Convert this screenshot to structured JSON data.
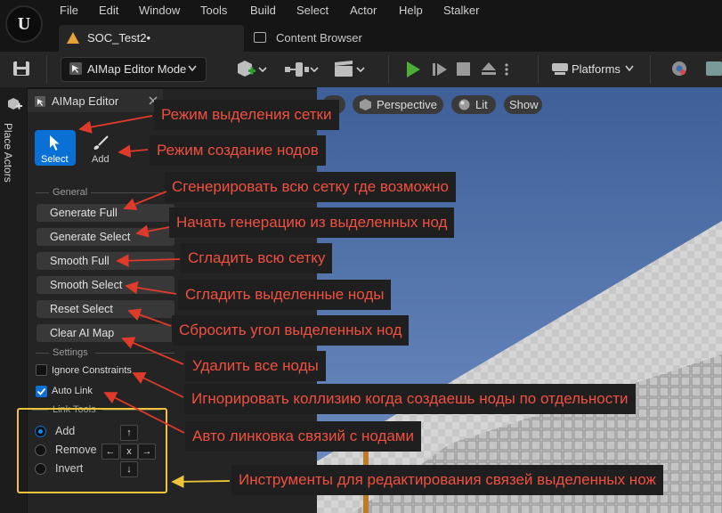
{
  "app": {
    "logo": "U"
  },
  "menu": [
    "File",
    "Edit",
    "Window",
    "Tools",
    "Build",
    "Select",
    "Actor",
    "Help",
    "Stalker"
  ],
  "tabs": {
    "level": "SOC_Test2•",
    "content_browser": "Content Browser"
  },
  "toolbar": {
    "mode": "AIMap Editor Mode",
    "platforms": "Platforms"
  },
  "sidebar": {
    "place_actors": "Place Actors"
  },
  "panel": {
    "title": "AIMap Editor",
    "modes": {
      "select": "Select",
      "add": "Add"
    },
    "general_header": "General",
    "buttons": [
      "Generate Full",
      "Generate Select",
      "Smooth Full",
      "Smooth Select",
      "Reset Select",
      "Clear AI Map"
    ],
    "settings_header": "Settings",
    "ignore_constraints": "Ignore Constraints",
    "auto_link": "Auto Link",
    "link_tools_header": "Link Tools",
    "link_options": [
      "Add",
      "Remove",
      "Invert"
    ],
    "arrows": {
      "up": "↑",
      "left": "←",
      "center": "x",
      "right": "→",
      "down": "↓"
    }
  },
  "viewport": {
    "perspective": "Perspective",
    "lit": "Lit",
    "show": "Show"
  },
  "annotations": [
    "Режим выделения сетки",
    "Режим создание нодов",
    "Сгенерировать всю сетку где возможно",
    "Начать генерацию из выделенных нод",
    "Сгладить всю сетку",
    "Сгладить выделенные ноды",
    "Сбросить угол выделенных нод",
    "Удалить все ноды",
    "Игнорировать коллизию когда создаешь ноды по отдельности",
    "Авто линковка связий с нодами",
    "Инструменты для редактирования связей выделенных нож"
  ],
  "colors": {
    "annotation_text": "#f05040",
    "accent": "#0a70d6",
    "play": "#4caf34",
    "highlight_box": "#f0c43a"
  }
}
